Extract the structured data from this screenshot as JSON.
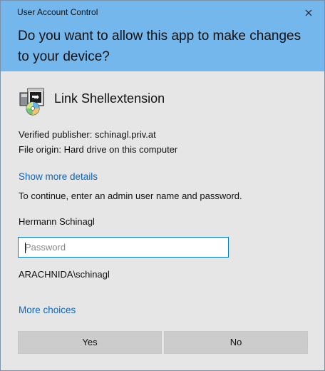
{
  "dialog": {
    "title": "User Account Control",
    "question": "Do you want to allow this app to make changes to your device?",
    "close_icon": "close-icon"
  },
  "app": {
    "name": "Link Shellextension",
    "icon": "installer-icon",
    "publisher_line": "Verified publisher: schinagl.priv.at",
    "origin_line": "File origin: Hard drive on this computer"
  },
  "links": {
    "show_details": "Show more details",
    "more_choices": "More choices"
  },
  "auth": {
    "instruction": "To continue, enter an admin user name and password.",
    "username": "Hermann Schinagl",
    "password_placeholder": "Password",
    "password_value": "",
    "domain_user": "ARACHNIDA\\schinagl"
  },
  "buttons": {
    "yes": "Yes",
    "no": "No"
  },
  "colors": {
    "header": "#74b7ec",
    "body": "#e6e6e6",
    "link": "#0a66c2",
    "input_border": "#0078d7",
    "button": "#cccccc"
  }
}
